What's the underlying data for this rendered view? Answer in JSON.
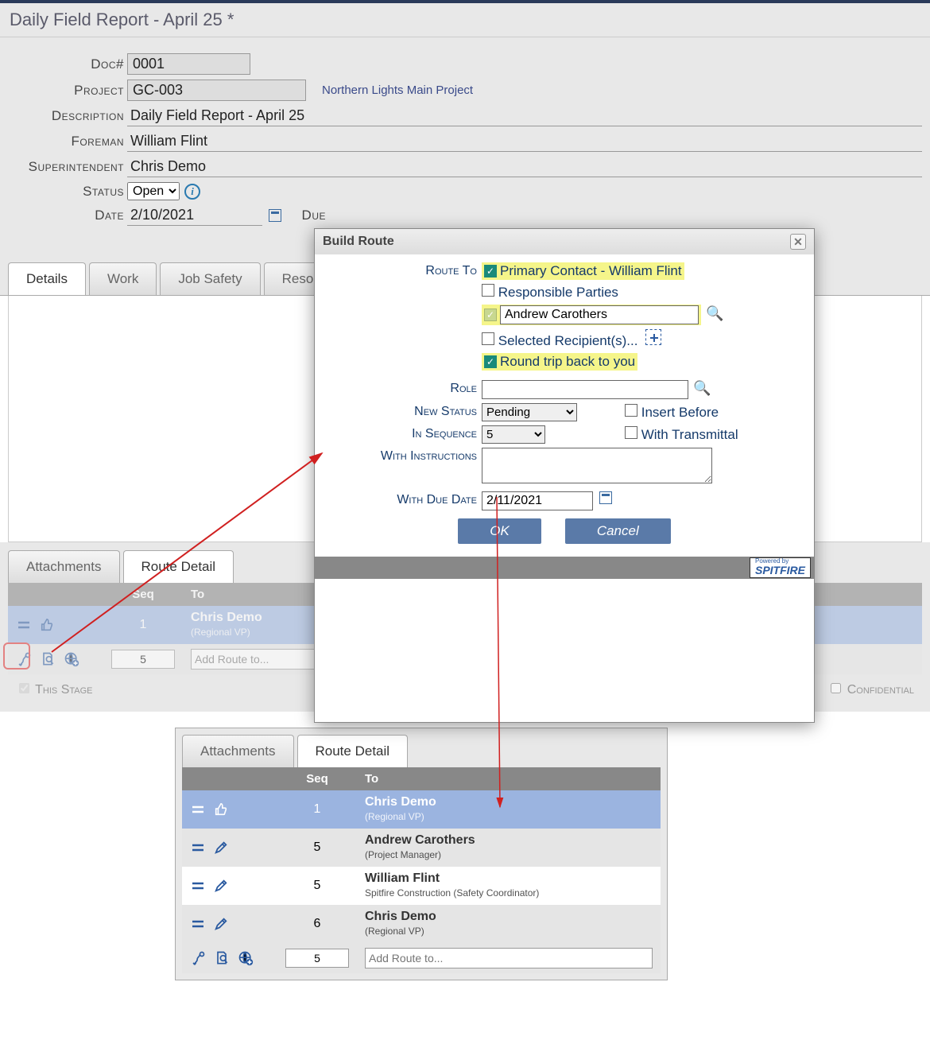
{
  "page_title": "Daily Field Report - April 25 *",
  "form": {
    "doc_label": "Doc#",
    "doc_value": "0001",
    "project_label": "Project",
    "project_value": "GC-003",
    "project_link": "Northern Lights Main Project",
    "description_label": "Description",
    "description_value": "Daily Field Report - April 25",
    "foreman_label": "Foreman",
    "foreman_value": "William Flint",
    "super_label": "Superintendent",
    "super_value": "Chris Demo",
    "status_label": "Status",
    "status_value": "Open",
    "date_label": "Date",
    "date_value": "2/10/2021",
    "due_label": "Due"
  },
  "tabs_main": [
    "Details",
    "Work",
    "Job Safety",
    "Resour"
  ],
  "tabs_lower": [
    "Attachments",
    "Route Detail"
  ],
  "route1": {
    "headers": {
      "seq": "Seq",
      "to": "To"
    },
    "row1": {
      "seq": "1",
      "name": "Chris Demo",
      "role": "(Regional VP)"
    },
    "add_seq": "5",
    "add_placeholder": "Add Route to...",
    "this_stage": "This Stage",
    "confidential": "Confidential"
  },
  "dialog": {
    "title": "Build Route",
    "route_to_label": "Route To",
    "primary": "Primary Contact - William Flint",
    "responsible": "Responsible Parties",
    "person": "Andrew Carothers",
    "selected": "Selected Recipient(s)...",
    "roundtrip": "Round trip back to you",
    "role_label": "Role",
    "role_value": "",
    "newstatus_label": "New Status",
    "newstatus_value": "Pending",
    "insert_before": "Insert Before",
    "with_transmittal": "With Transmittal",
    "inseq_label": "In Sequence",
    "inseq_value": "5",
    "instr_label": "With Instructions",
    "instr_value": "",
    "duedate_label": "With Due Date",
    "duedate_value": "2/11/2021",
    "ok": "OK",
    "cancel": "Cancel",
    "brand": "SPITFIRE",
    "brand_sub": "Powered by"
  },
  "route2": {
    "headers": {
      "seq": "Seq",
      "to": "To"
    },
    "rows": [
      {
        "seq": "1",
        "name": "Chris Demo",
        "role": "(Regional VP)",
        "blue": true
      },
      {
        "seq": "5",
        "name": "Andrew Carothers",
        "role": "(Project Manager)"
      },
      {
        "seq": "5",
        "name": "William Flint",
        "role": "Spitfire Construction (Safety Coordinator)"
      },
      {
        "seq": "6",
        "name": "Chris Demo",
        "role": "(Regional VP)"
      }
    ],
    "add_seq": "5",
    "add_placeholder": "Add Route to..."
  }
}
